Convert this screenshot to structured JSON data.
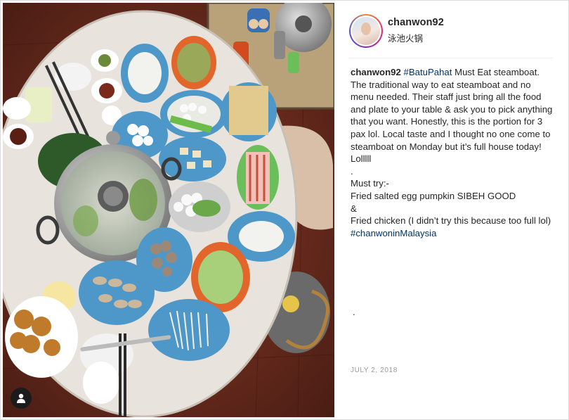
{
  "post": {
    "username": "chanwon92",
    "location": "泳池火锅",
    "caption": {
      "username": "chanwon92",
      "hashtag_location": "#BatuPahat",
      "text_main": " Must Eat steamboat. The traditional way to eat steamboat and no menu needed. Their staff just bring all the food and plate to your table & ask you to pick anything that you want. Honestly, this is the portion for 3 pax lol. Local taste and I thought no one come to steamboat on Monday but it’s full house today! Lolllll\n.\nMust try:-\nFried salted egg pumpkin SIBEH GOOD\n&\nFried chicken (I didn’t try this because too full lol) ",
      "hashtag_end": "#chanwoninMalaysia"
    },
    "trailing_dot": ".",
    "date": "JULY 2, 2018"
  },
  "icons": {
    "tag_badge": "user-tag-icon",
    "avatar": "profile-avatar"
  },
  "colors": {
    "hashtag": "#003569",
    "border": "#dbdbdb",
    "muted": "#999999",
    "plate_blue": "#4e97c9",
    "plate_orange": "#e2652b",
    "floor": "#6b2a1c"
  }
}
